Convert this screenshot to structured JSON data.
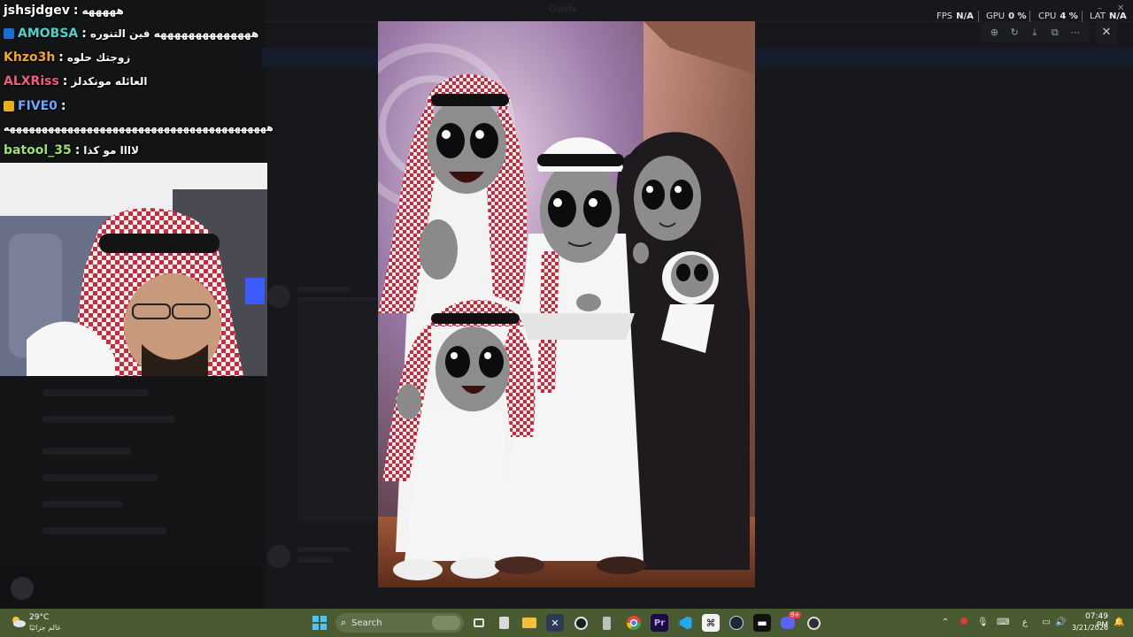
{
  "window": {
    "title": "Guilds"
  },
  "performance": {
    "fps_label": "FPS",
    "fps_value": "N/A",
    "gpu_label": "GPU",
    "gpu_value": "0 %",
    "cpu_label": "CPU",
    "cpu_value": "4 %",
    "lat_label": "LAT",
    "lat_value": "N/A"
  },
  "chat": {
    "messages": [
      {
        "user": "jshsjdgev",
        "text": "هههههه",
        "color": "#ffffff",
        "badge": ""
      },
      {
        "user": "AMOBSA",
        "text": "ههههههههههههههه فين التنوره",
        "color": "#4fd1c5",
        "badge": "play-badge"
      },
      {
        "user": "Khzo3h",
        "text": "زوجتك حلوه",
        "color": "#f5a524",
        "badge": ""
      },
      {
        "user": "ALXRiss",
        "text": "العائله مونكدلز",
        "color": "#f05a7e",
        "badge": ""
      },
      {
        "user": "FIVE0",
        "text": "",
        "color": "#6ea6ff",
        "badge": "crown-badge"
      },
      {
        "user": "",
        "text": "هههههههههههههههههههههههههههههههههههههههههه",
        "color": "#ffffff",
        "badge": ""
      },
      {
        "user": "batool_35",
        "text": "لاااا مو كذا",
        "color": "#9be36b",
        "badge": ""
      }
    ]
  },
  "taskbar": {
    "weather_temp": "29°C",
    "weather_desc": "غالم جزائيًا",
    "search_placeholder": "Search",
    "time": "07:49 PM",
    "date": "3/21/2026",
    "apps": [
      "windows-start-icon",
      "search-icon",
      "task-view-icon",
      "calculator-icon",
      "file-explorer-icon",
      "terminal-icon",
      "github-icon",
      "usb-icon",
      "chrome-icon",
      "premiere-icon",
      "vscode-icon",
      "capcut-icon",
      "steam-icon",
      "spotify-icon",
      "discord-icon",
      "obs-icon"
    ],
    "discord_badge": "9+"
  },
  "colors": {
    "taskbar": "#4a5a31",
    "accent": "#0078d4"
  }
}
